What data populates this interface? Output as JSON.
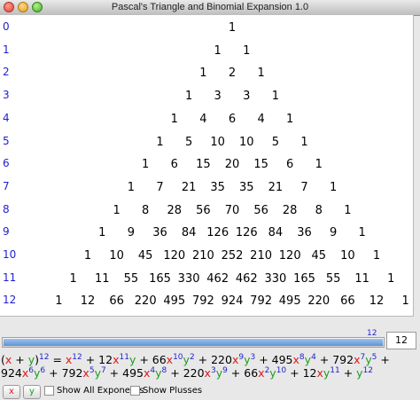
{
  "window": {
    "title": "Pascal's Triangle and Binomial Expansion 1.0"
  },
  "triangle": {
    "rows": [
      {
        "n": "0",
        "values": [
          "1"
        ]
      },
      {
        "n": "1",
        "values": [
          "1",
          "1"
        ]
      },
      {
        "n": "2",
        "values": [
          "1",
          "2",
          "1"
        ]
      },
      {
        "n": "3",
        "values": [
          "1",
          "3",
          "3",
          "1"
        ]
      },
      {
        "n": "4",
        "values": [
          "1",
          "4",
          "6",
          "4",
          "1"
        ]
      },
      {
        "n": "5",
        "values": [
          "1",
          "5",
          "10",
          "10",
          "5",
          "1"
        ]
      },
      {
        "n": "6",
        "values": [
          "1",
          "6",
          "15",
          "20",
          "15",
          "6",
          "1"
        ]
      },
      {
        "n": "7",
        "values": [
          "1",
          "7",
          "21",
          "35",
          "35",
          "21",
          "7",
          "1"
        ]
      },
      {
        "n": "8",
        "values": [
          "1",
          "8",
          "28",
          "56",
          "70",
          "56",
          "28",
          "8",
          "1"
        ]
      },
      {
        "n": "9",
        "values": [
          "1",
          "9",
          "36",
          "84",
          "126",
          "126",
          "84",
          "36",
          "9",
          "1"
        ]
      },
      {
        "n": "10",
        "values": [
          "1",
          "10",
          "45",
          "120",
          "210",
          "252",
          "210",
          "120",
          "45",
          "10",
          "1"
        ]
      },
      {
        "n": "11",
        "values": [
          "1",
          "11",
          "55",
          "165",
          "330",
          "462",
          "462",
          "330",
          "165",
          "55",
          "11",
          "1"
        ]
      },
      {
        "n": "12",
        "values": [
          "1",
          "12",
          "66",
          "220",
          "495",
          "792",
          "924",
          "792",
          "495",
          "220",
          "66",
          "12",
          "1"
        ]
      }
    ]
  },
  "slider": {
    "value": "12",
    "max_value": 12,
    "level": 1.0
  },
  "power_field": {
    "value": "12"
  },
  "expansion": {
    "lhs_open": "(",
    "lhs_x": "x",
    "lhs_plus": " + ",
    "lhs_y": "y",
    "lhs_close": ")",
    "power": "12",
    "equals": " = ",
    "terms": [
      {
        "coef": "",
        "x": "x",
        "xe": "12",
        "y": "",
        "ye": ""
      },
      {
        "coef": "12",
        "x": "x",
        "xe": "11",
        "y": "y",
        "ye": ""
      },
      {
        "coef": "66",
        "x": "x",
        "xe": "10",
        "y": "y",
        "ye": "2"
      },
      {
        "coef": "220",
        "x": "x",
        "xe": "9",
        "y": "y",
        "ye": "3"
      },
      {
        "coef": "495",
        "x": "x",
        "xe": "8",
        "y": "y",
        "ye": "4"
      },
      {
        "coef": "792",
        "x": "x",
        "xe": "7",
        "y": "y",
        "ye": "5"
      },
      {
        "coef": "924",
        "x": "x",
        "xe": "6",
        "y": "y",
        "ye": "6"
      },
      {
        "coef": "792",
        "x": "x",
        "xe": "5",
        "y": "y",
        "ye": "7"
      },
      {
        "coef": "495",
        "x": "x",
        "xe": "4",
        "y": "y",
        "ye": "8"
      },
      {
        "coef": "220",
        "x": "x",
        "xe": "3",
        "y": "y",
        "ye": "9"
      },
      {
        "coef": "66",
        "x": "x",
        "xe": "2",
        "y": "y",
        "ye": "10"
      },
      {
        "coef": "12",
        "x": "x",
        "xe": "",
        "y": "y",
        "ye": "11"
      },
      {
        "coef": "",
        "x": "",
        "xe": "",
        "y": "y",
        "ye": "12"
      }
    ],
    "plus": " + "
  },
  "controls": {
    "x_button": "x",
    "y_button": "y",
    "show_all_exponents": "Show All Exponents",
    "show_plusses": "Show Plusses"
  },
  "colors": {
    "x": "#e01818",
    "y": "#1aa01a",
    "row_label": "#1f1fd0"
  }
}
